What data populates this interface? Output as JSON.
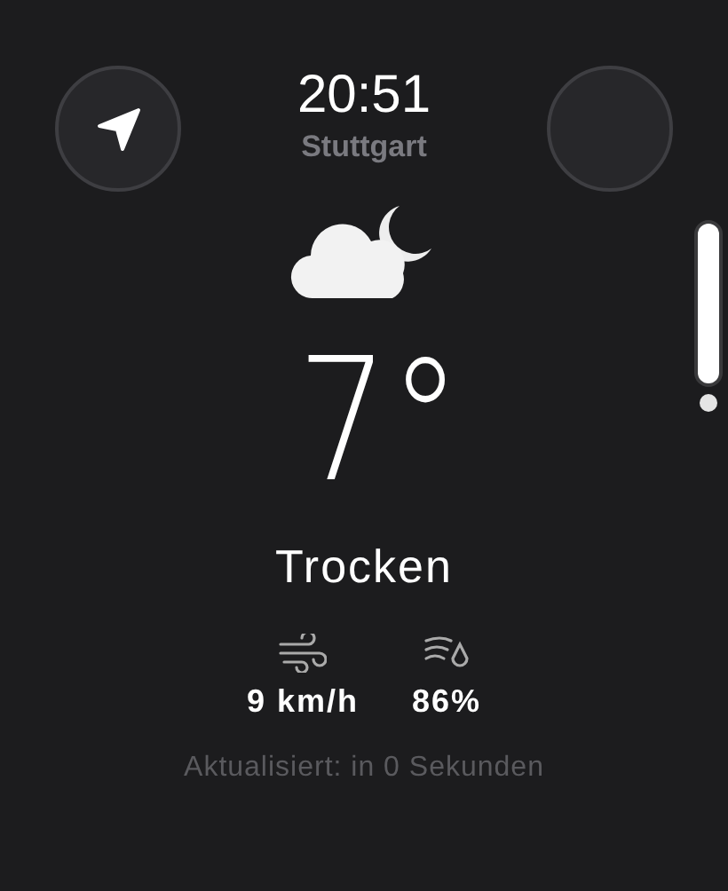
{
  "time": "20:51",
  "location": {
    "name": "Stuttgart"
  },
  "temperature": "7°",
  "condition": "Trocken",
  "details": [
    {
      "kind": "wind",
      "value": "9 km/h"
    },
    {
      "kind": "humidity",
      "value": "86%"
    }
  ],
  "updated": "Aktualisiert: in 0 Sekunden"
}
